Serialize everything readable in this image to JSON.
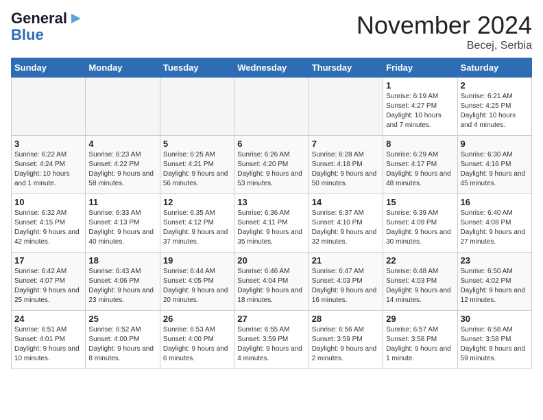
{
  "header": {
    "logo_general": "General",
    "logo_blue": "Blue",
    "month_title": "November 2024",
    "location": "Becej, Serbia"
  },
  "weekdays": [
    "Sunday",
    "Monday",
    "Tuesday",
    "Wednesday",
    "Thursday",
    "Friday",
    "Saturday"
  ],
  "weeks": [
    [
      {
        "day": "",
        "detail": ""
      },
      {
        "day": "",
        "detail": ""
      },
      {
        "day": "",
        "detail": ""
      },
      {
        "day": "",
        "detail": ""
      },
      {
        "day": "",
        "detail": ""
      },
      {
        "day": "1",
        "detail": "Sunrise: 6:19 AM\nSunset: 4:27 PM\nDaylight: 10 hours and 7 minutes."
      },
      {
        "day": "2",
        "detail": "Sunrise: 6:21 AM\nSunset: 4:25 PM\nDaylight: 10 hours and 4 minutes."
      }
    ],
    [
      {
        "day": "3",
        "detail": "Sunrise: 6:22 AM\nSunset: 4:24 PM\nDaylight: 10 hours and 1 minute."
      },
      {
        "day": "4",
        "detail": "Sunrise: 6:23 AM\nSunset: 4:22 PM\nDaylight: 9 hours and 58 minutes."
      },
      {
        "day": "5",
        "detail": "Sunrise: 6:25 AM\nSunset: 4:21 PM\nDaylight: 9 hours and 56 minutes."
      },
      {
        "day": "6",
        "detail": "Sunrise: 6:26 AM\nSunset: 4:20 PM\nDaylight: 9 hours and 53 minutes."
      },
      {
        "day": "7",
        "detail": "Sunrise: 6:28 AM\nSunset: 4:18 PM\nDaylight: 9 hours and 50 minutes."
      },
      {
        "day": "8",
        "detail": "Sunrise: 6:29 AM\nSunset: 4:17 PM\nDaylight: 9 hours and 48 minutes."
      },
      {
        "day": "9",
        "detail": "Sunrise: 6:30 AM\nSunset: 4:16 PM\nDaylight: 9 hours and 45 minutes."
      }
    ],
    [
      {
        "day": "10",
        "detail": "Sunrise: 6:32 AM\nSunset: 4:15 PM\nDaylight: 9 hours and 42 minutes."
      },
      {
        "day": "11",
        "detail": "Sunrise: 6:33 AM\nSunset: 4:13 PM\nDaylight: 9 hours and 40 minutes."
      },
      {
        "day": "12",
        "detail": "Sunrise: 6:35 AM\nSunset: 4:12 PM\nDaylight: 9 hours and 37 minutes."
      },
      {
        "day": "13",
        "detail": "Sunrise: 6:36 AM\nSunset: 4:11 PM\nDaylight: 9 hours and 35 minutes."
      },
      {
        "day": "14",
        "detail": "Sunrise: 6:37 AM\nSunset: 4:10 PM\nDaylight: 9 hours and 32 minutes."
      },
      {
        "day": "15",
        "detail": "Sunrise: 6:39 AM\nSunset: 4:09 PM\nDaylight: 9 hours and 30 minutes."
      },
      {
        "day": "16",
        "detail": "Sunrise: 6:40 AM\nSunset: 4:08 PM\nDaylight: 9 hours and 27 minutes."
      }
    ],
    [
      {
        "day": "17",
        "detail": "Sunrise: 6:42 AM\nSunset: 4:07 PM\nDaylight: 9 hours and 25 minutes."
      },
      {
        "day": "18",
        "detail": "Sunrise: 6:43 AM\nSunset: 4:06 PM\nDaylight: 9 hours and 23 minutes."
      },
      {
        "day": "19",
        "detail": "Sunrise: 6:44 AM\nSunset: 4:05 PM\nDaylight: 9 hours and 20 minutes."
      },
      {
        "day": "20",
        "detail": "Sunrise: 6:46 AM\nSunset: 4:04 PM\nDaylight: 9 hours and 18 minutes."
      },
      {
        "day": "21",
        "detail": "Sunrise: 6:47 AM\nSunset: 4:03 PM\nDaylight: 9 hours and 16 minutes."
      },
      {
        "day": "22",
        "detail": "Sunrise: 6:48 AM\nSunset: 4:03 PM\nDaylight: 9 hours and 14 minutes."
      },
      {
        "day": "23",
        "detail": "Sunrise: 6:50 AM\nSunset: 4:02 PM\nDaylight: 9 hours and 12 minutes."
      }
    ],
    [
      {
        "day": "24",
        "detail": "Sunrise: 6:51 AM\nSunset: 4:01 PM\nDaylight: 9 hours and 10 minutes."
      },
      {
        "day": "25",
        "detail": "Sunrise: 6:52 AM\nSunset: 4:00 PM\nDaylight: 9 hours and 8 minutes."
      },
      {
        "day": "26",
        "detail": "Sunrise: 6:53 AM\nSunset: 4:00 PM\nDaylight: 9 hours and 6 minutes."
      },
      {
        "day": "27",
        "detail": "Sunrise: 6:55 AM\nSunset: 3:59 PM\nDaylight: 9 hours and 4 minutes."
      },
      {
        "day": "28",
        "detail": "Sunrise: 6:56 AM\nSunset: 3:59 PM\nDaylight: 9 hours and 2 minutes."
      },
      {
        "day": "29",
        "detail": "Sunrise: 6:57 AM\nSunset: 3:58 PM\nDaylight: 9 hours and 1 minute."
      },
      {
        "day": "30",
        "detail": "Sunrise: 6:58 AM\nSunset: 3:58 PM\nDaylight: 8 hours and 59 minutes."
      }
    ]
  ]
}
